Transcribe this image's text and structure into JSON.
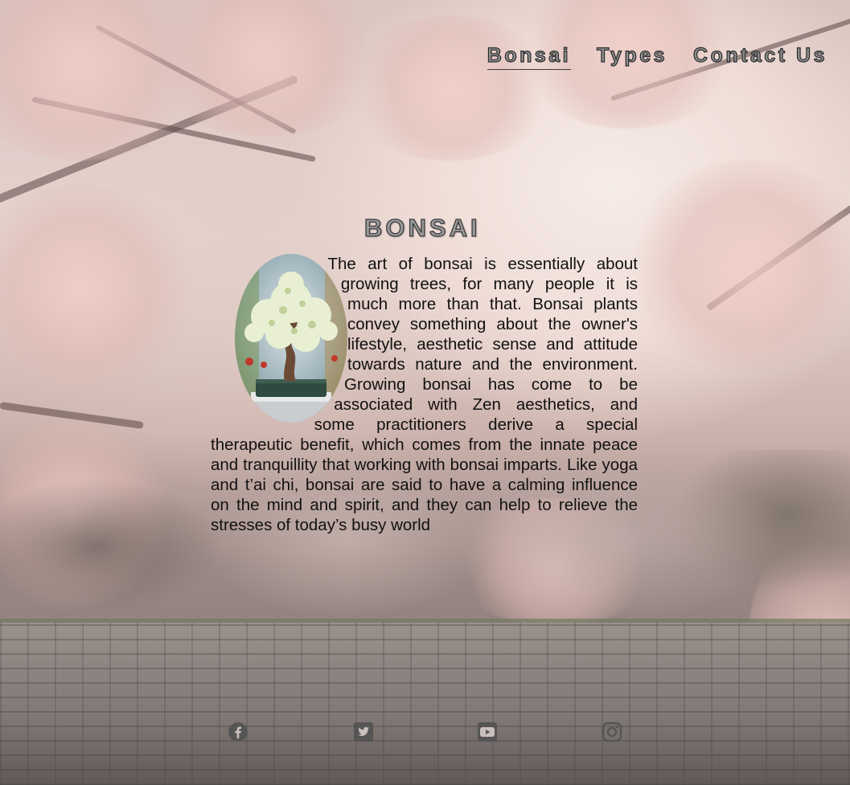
{
  "nav": {
    "items": [
      {
        "label": "Bonsai",
        "active": true
      },
      {
        "label": "Types",
        "active": false
      },
      {
        "label": "Contact Us",
        "active": false
      }
    ]
  },
  "main": {
    "title": "BONSAI",
    "body": "The art of bonsai is essentially about growing trees, for many people it is much more than that. Bonsai plants convey something about the owner's lifestyle, aesthetic sense and attitude towards nature and the environment. Growing bonsai has come to be associated with Zen aesthetics, and some practitioners derive a special therapeutic benefit, which comes from the innate peace and tranquillity that working with bonsai imparts. Like yoga and t’ai chi, bonsai are said to have a calming influence on the mind and spirit, and they can help to relieve the stresses of today’s busy world"
  },
  "social": {
    "icons": [
      "facebook-icon",
      "twitter-icon",
      "youtube-icon",
      "instagram-icon"
    ]
  },
  "colors": {
    "nav_fill": "#8f8f8f",
    "nav_stroke": "#2a2a2a",
    "body_text": "#111111",
    "icon_color": "#555555"
  }
}
